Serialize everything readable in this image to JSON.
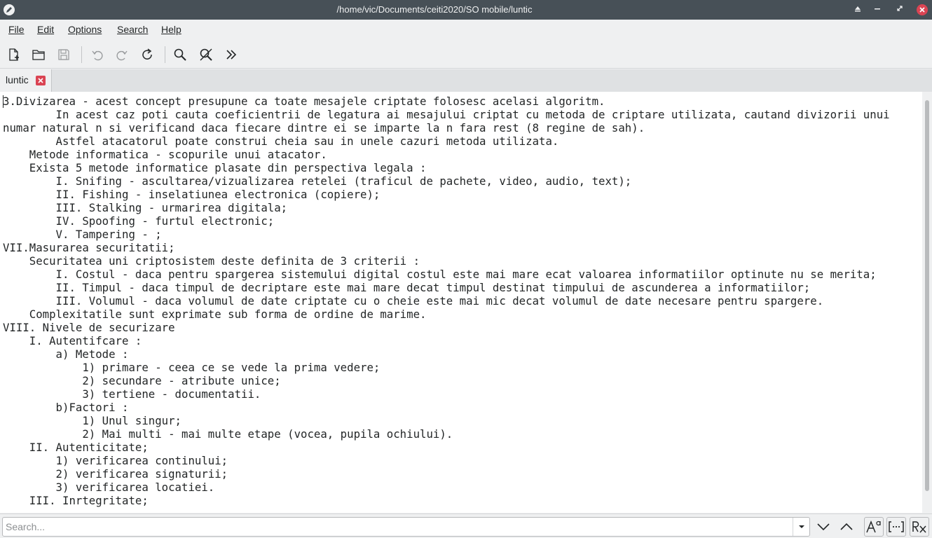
{
  "window": {
    "title": "/home/vic/Documents/ceiti2020/SO mobile/luntic",
    "accent_color": "#475057",
    "close_color": "#da4453"
  },
  "menu": {
    "file": "File",
    "edit": "Edit",
    "options": "Options",
    "search": "Search",
    "help": "Help"
  },
  "toolbar": {
    "icons": [
      "new-document-icon",
      "open-folder-icon",
      "save-icon",
      "undo-icon",
      "redo-icon",
      "reload-icon",
      "find-icon",
      "replace-icon",
      "more-icon"
    ]
  },
  "tab": {
    "label": "luntic"
  },
  "editor": {
    "content": "3.Divizarea - acest concept presupune ca toate mesajele criptate folosesc acelasi algoritm.\n        In acest caz poti cauta coeficientrii de legatura ai mesajului criptat cu metoda de criptare utilizata, cautand divizorii unui\nnumar natural n si verificand daca fiecare dintre ei se imparte la n fara rest (8 regine de sah).\n        Astfel atacatorul poate construi cheia sau in unele cazuri metoda utilizata.\n    Metode informatica - scopurile unui atacator.\n    Exista 5 metode informatice plasate din perspectiva legala :\n        I. Snifing - ascultarea/vizualizarea retelei (traficul de pachete, video, audio, text);\n        II. Fishing - inselatiunea electronica (copiere);\n        III. Stalking - urmarirea digitala;\n        IV. Spoofing - furtul electronic;\n        V. Tampering - ;\nVII.Masurarea securitatii;\n    Securitatea uni criptosistem deste definita de 3 criterii :\n        I. Costul - daca pentru spargerea sistemului digital costul este mai mare ecat valoarea informatiilor optinute nu se merita;\n        II. Timpul - daca timpul de decriptare este mai mare decat timpul destinat timpului de ascunderea a informatiilor;\n        III. Volumul - daca volumul de date criptate cu o cheie este mai mic decat volumul de date necesare pentru spargere.\n    Complexitatile sunt exprimate sub forma de ordine de marime.\nVIII. Nivele de securizare\n    I. Autentifcare :\n        a) Metode :\n            1) primare - ceea ce se vede la prima vedere;\n            2) secundare - atribute unice;\n            3) tertiene - documentatii.\n        b)Factori :\n            1) Unul singur;\n            2) Mai multi - mai multe etape (vocea, pupila ochiului).\n    II. Autenticitate;\n        1) verificarea continului;\n        2) verificarea signaturii;\n        3) verificarea locatiei.\n    III. Inrtegritate;"
  },
  "search": {
    "placeholder": "Search..."
  }
}
